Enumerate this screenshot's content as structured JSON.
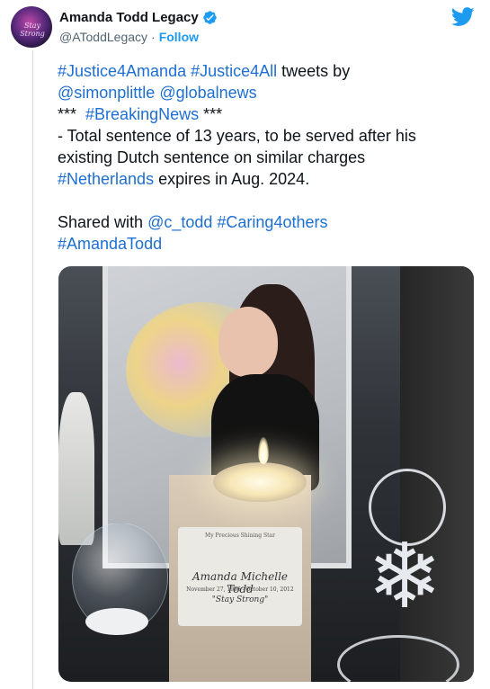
{
  "colors": {
    "link": "#1d6fd1",
    "accent": "#1d9bf0",
    "text": "#0f1419",
    "muted": "#536471"
  },
  "header": {
    "name": "Amanda Todd Legacy",
    "handle": "@AToddLegacy",
    "separator": "·",
    "follow_label": "Follow",
    "avatar_text": "Stay Strong",
    "verified_icon": "verified-badge-icon",
    "platform_icon": "twitter-bird-icon"
  },
  "tweet": {
    "line1": {
      "tag1": "#Justice4Amanda",
      "sep": " ",
      "tag2": "#Justice4All",
      "text": " tweets by"
    },
    "line2": {
      "mention1": "@simonplittle",
      "sep": " ",
      "mention2": "@globalnews"
    },
    "line3": {
      "prefix": "***  ",
      "tag": "#BreakingNews",
      "suffix": " ***"
    },
    "line4": "- Total sentence of 13 years, to be served after his",
    "line5": "existing Dutch sentence on similar charges",
    "line6": {
      "tag": "#Netherlands",
      "text": " expires in Aug. 2024."
    },
    "line7": {
      "prefix": "Shared with ",
      "mention": "@c_todd",
      "sep": " ",
      "tag": "#Caring4others"
    },
    "line8": {
      "tag": "#AmandaTodd"
    }
  },
  "photo": {
    "candle_top": "My Precious Shining Star",
    "candle_name": "Amanda Michelle Todd",
    "candle_dates": "November 27, 1996 - October 10, 2012",
    "candle_motto": "\"Stay Strong\"",
    "snowflake_glyph": "❄"
  }
}
